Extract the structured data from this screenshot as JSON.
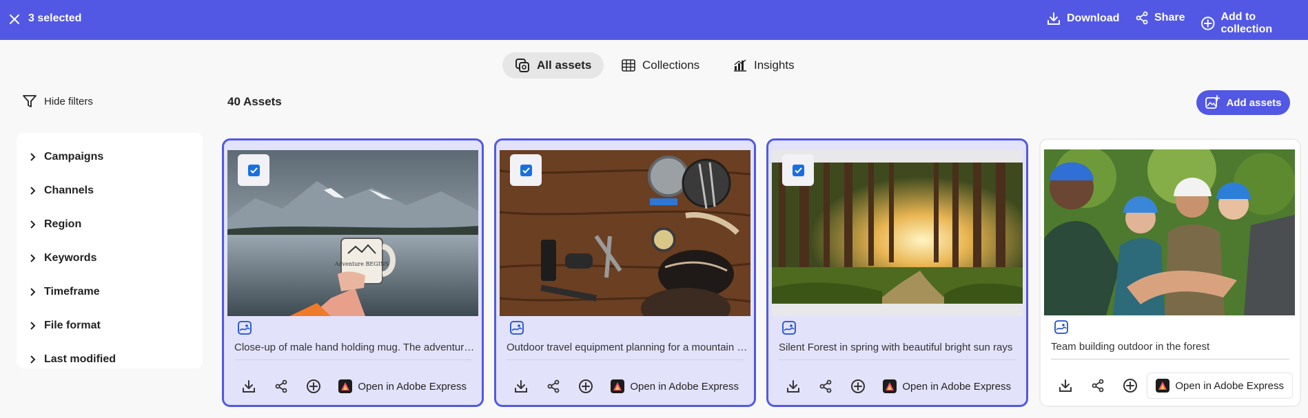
{
  "selection_bar": {
    "count_label": "3 selected",
    "close_icon": "close-icon",
    "actions": [
      {
        "label": "Download",
        "icon": "download-icon"
      },
      {
        "label": "Share",
        "icon": "share-icon"
      },
      {
        "label": "Add to collection",
        "icon": "add-circle-icon"
      }
    ]
  },
  "tabs": [
    {
      "label": "All assets",
      "icon": "assets-icon",
      "active": true
    },
    {
      "label": "Collections",
      "icon": "grid-icon",
      "active": false
    },
    {
      "label": "Insights",
      "icon": "insights-icon",
      "active": false
    }
  ],
  "toolbar": {
    "hide_filters_label": "Hide filters",
    "asset_count": "40 Assets",
    "add_assets_label": "Add assets"
  },
  "filters": [
    "Campaigns",
    "Channels",
    "Region",
    "Keywords",
    "Timeframe",
    "File format",
    "Last modified"
  ],
  "cards": [
    {
      "title": "Close-up of male hand holding mug. The adventure begins",
      "selected": true,
      "open_label": "Open in Adobe Express"
    },
    {
      "title": "Outdoor travel equipment planning for a mountain trip",
      "selected": true,
      "open_label": "Open in Adobe Express"
    },
    {
      "title": "Silent Forest in spring with beautiful bright sun rays",
      "selected": true,
      "open_label": "Open in Adobe Express"
    },
    {
      "title": "Team building outdoor in the forest",
      "selected": false,
      "open_label": "Open in Adobe Express"
    }
  ],
  "mug_text": "Adventure BEGINS",
  "colors": {
    "accent": "#5258e4",
    "checkbox": "#1a6fe0",
    "selected_card_bg": "#e2e2fb"
  }
}
